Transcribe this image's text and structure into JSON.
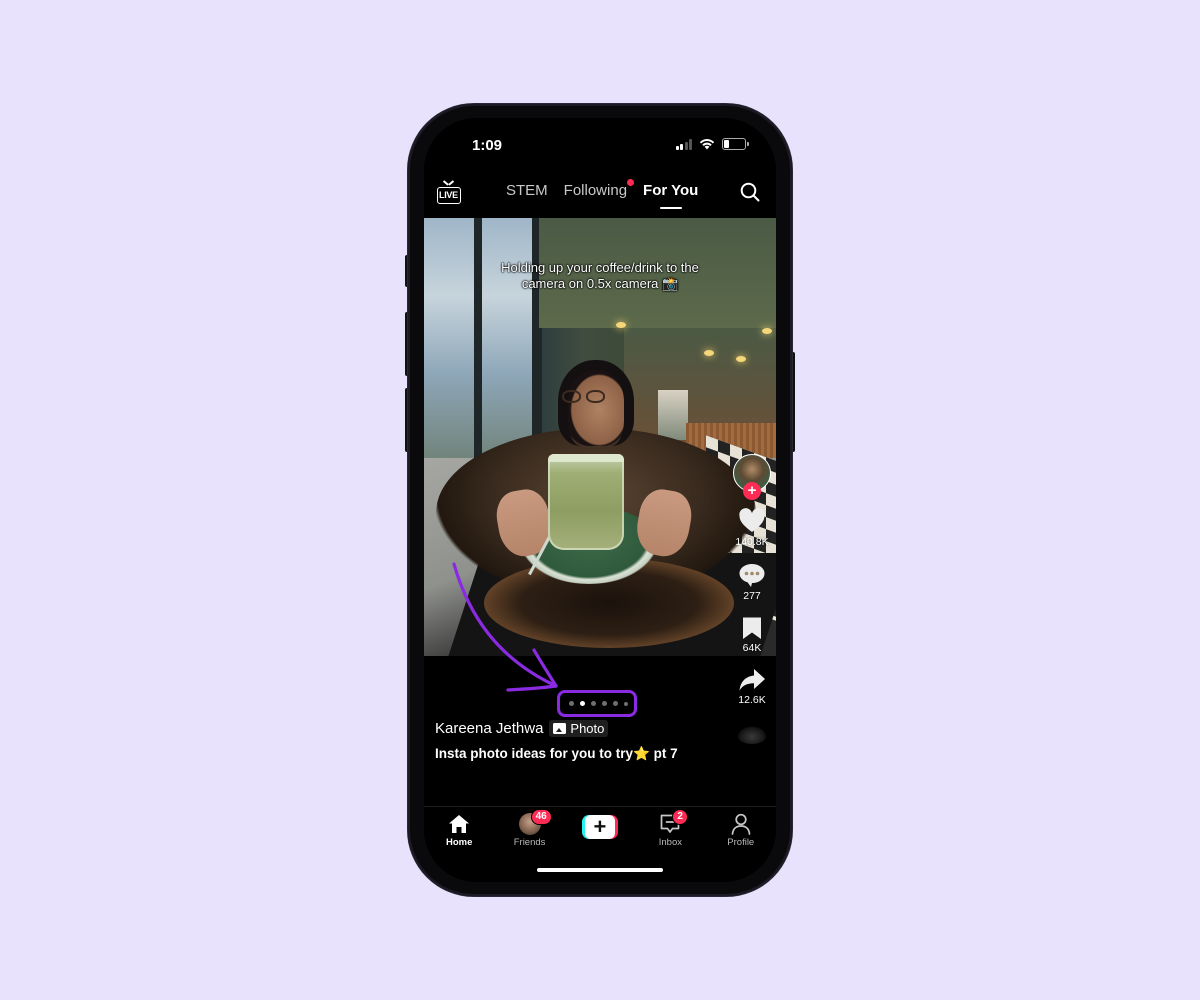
{
  "status_bar": {
    "time": "1:09",
    "signal_bars": 2,
    "signal_total": 4,
    "wifi": true,
    "battery_level": 0.2
  },
  "top_nav": {
    "live_label": "LIVE",
    "tabs": [
      {
        "label": "STEM",
        "active": false,
        "notification_dot": false
      },
      {
        "label": "Following",
        "active": false,
        "notification_dot": true
      },
      {
        "label": "For You",
        "active": true,
        "notification_dot": false
      }
    ],
    "search_icon": "search-icon"
  },
  "post": {
    "overlay_caption_line1": "Holding up your coffee/drink to the",
    "overlay_caption_line2": "camera on 0.5x camera 📸",
    "author": "Kareena Jethwa",
    "type_badge": "Photo",
    "description": "Insta photo ideas for you to try⭐ pt 7",
    "carousel": {
      "total": 6,
      "current": 2
    }
  },
  "actions": {
    "likes": "140.8K",
    "comments": "277",
    "saves": "64K",
    "shares": "12.6K"
  },
  "bottom_nav": {
    "items": [
      {
        "label": "Home",
        "icon": "home-icon",
        "active": true
      },
      {
        "label": "Friends",
        "icon": "friends-avatar",
        "badge": "46"
      },
      {
        "label": "",
        "icon": "create-plus-icon"
      },
      {
        "label": "Inbox",
        "icon": "inbox-icon",
        "badge": "2"
      },
      {
        "label": "Profile",
        "icon": "profile-icon"
      }
    ]
  },
  "annotation": {
    "color": "#8a2be2",
    "target": "carousel-pagination-dots"
  },
  "colors": {
    "background": "#e8e2fd",
    "accent_red": "#fe2c55",
    "accent_cyan": "#25f4ee"
  }
}
